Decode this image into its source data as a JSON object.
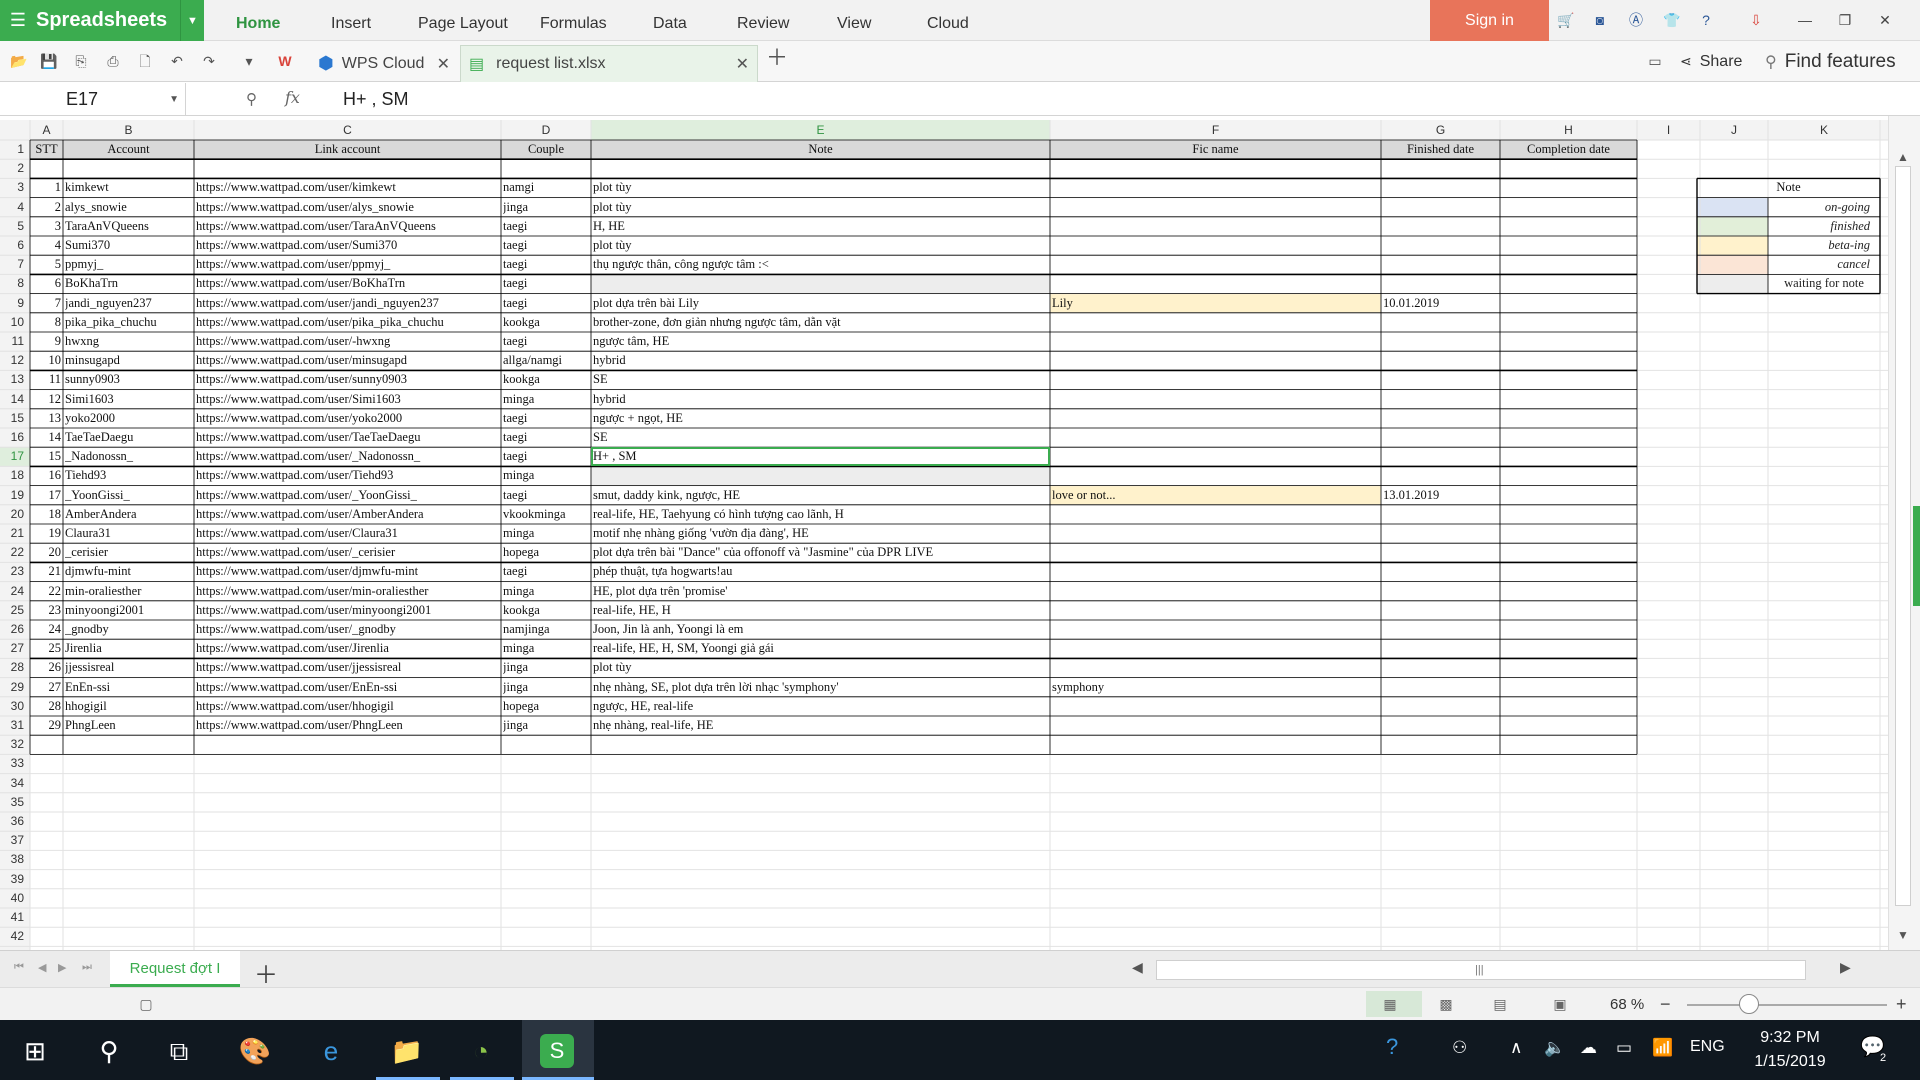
{
  "app": {
    "name": "Spreadsheets",
    "menu_tabs": [
      "Home",
      "Insert",
      "Page Layout",
      "Formulas",
      "Data",
      "Review",
      "View",
      "Cloud"
    ],
    "active_tab": "Home",
    "signin": "Sign in"
  },
  "toolbar": {
    "wps_cloud": "WPS Cloud",
    "doc_name": "request list.xlsx",
    "share": "Share",
    "find": "Find features"
  },
  "formula_bar": {
    "cell_ref": "E17",
    "fx": "fx",
    "content": "H+ , SM"
  },
  "grid": {
    "columns": [
      "A",
      "B",
      "C",
      "D",
      "E",
      "F",
      "G",
      "H",
      "I",
      "J",
      "K"
    ],
    "headers": [
      "STT",
      "Account",
      "Link account",
      "Couple",
      "Note",
      "Fic name",
      "Finished date",
      "Completion date"
    ],
    "rows": [
      {
        "stt": "1",
        "account": "kimkewt",
        "link": "https://www.wattpad.com/user/kimkewt",
        "couple": "namgi",
        "note": "plot tùy",
        "fic": "",
        "finished": ""
      },
      {
        "stt": "2",
        "account": "alys_snowie",
        "link": "https://www.wattpad.com/user/alys_snowie",
        "couple": "jinga",
        "note": "plot tùy",
        "fic": "",
        "finished": ""
      },
      {
        "stt": "3",
        "account": "TaraAnVQueens",
        "link": "https://www.wattpad.com/user/TaraAnVQueens",
        "couple": "taegi",
        "note": "H, HE",
        "fic": "",
        "finished": ""
      },
      {
        "stt": "4",
        "account": "Sumi370",
        "link": "https://www.wattpad.com/user/Sumi370",
        "couple": "taegi",
        "note": "plot tùy",
        "fic": "",
        "finished": ""
      },
      {
        "stt": "5",
        "account": "ppmyj_",
        "link": "https://www.wattpad.com/user/ppmyj_",
        "couple": "taegi",
        "note": "thụ ngược thân, công ngược tâm :<",
        "fic": "",
        "finished": ""
      },
      {
        "stt": "6",
        "account": "BoKhaTrn",
        "link": "https://www.wattpad.com/user/BoKhaTrn",
        "couple": "taegi",
        "note": "",
        "fic": "",
        "finished": "",
        "status": "waiting"
      },
      {
        "stt": "7",
        "account": "jandi_nguyen237",
        "link": "https://www.wattpad.com/user/jandi_nguyen237",
        "couple": "taegi",
        "note": "plot dựa trên bài Lily",
        "fic": "Lily",
        "finished": "10.01.2019",
        "status": "beta"
      },
      {
        "stt": "8",
        "account": "pika_pika_chuchu",
        "link": "https://www.wattpad.com/user/pika_pika_chuchu",
        "couple": "kookga",
        "note": "brother-zone, đơn giản nhưng ngược tâm, dằn vặt",
        "fic": "",
        "finished": ""
      },
      {
        "stt": "9",
        "account": "hwxng",
        "link": "https://www.wattpad.com/user/-hwxng",
        "couple": "taegi",
        "note": "ngược tâm, HE",
        "fic": "",
        "finished": ""
      },
      {
        "stt": "10",
        "account": "minsugapd",
        "link": "https://www.wattpad.com/user/minsugapd",
        "couple": "allga/namgi",
        "note": "hybrid",
        "fic": "",
        "finished": ""
      },
      {
        "stt": "11",
        "account": "sunny0903",
        "link": "https://www.wattpad.com/user/sunny0903",
        "couple": "kookga",
        "note": "SE",
        "fic": "",
        "finished": ""
      },
      {
        "stt": "12",
        "account": "Simi1603",
        "link": "https://www.wattpad.com/user/Simi1603",
        "couple": "minga",
        "note": "hybrid",
        "fic": "",
        "finished": ""
      },
      {
        "stt": "13",
        "account": "yoko2000",
        "link": "https://www.wattpad.com/user/yoko2000",
        "couple": "taegi",
        "note": "ngược + ngọt, HE",
        "fic": "",
        "finished": ""
      },
      {
        "stt": "14",
        "account": "TaeTaeDaegu",
        "link": "https://www.wattpad.com/user/TaeTaeDaegu",
        "couple": "taegi",
        "note": "SE",
        "fic": "",
        "finished": ""
      },
      {
        "stt": "15",
        "account": "_Nadonossn_",
        "link": "https://www.wattpad.com/user/_Nadonossn_",
        "couple": "taegi",
        "note": "H+ , SM",
        "fic": "",
        "finished": ""
      },
      {
        "stt": "16",
        "account": "Tiehd93",
        "link": "https://www.wattpad.com/user/Tiehd93",
        "couple": "minga",
        "note": "",
        "fic": "",
        "finished": "",
        "status": "waiting"
      },
      {
        "stt": "17",
        "account": "_YoonGissi_",
        "link": "https://www.wattpad.com/user/_YoonGissi_",
        "couple": "taegi",
        "note": "smut, daddy kink, ngược, HE",
        "fic": "love or not...",
        "finished": "13.01.2019",
        "status": "beta"
      },
      {
        "stt": "18",
        "account": "AmberAndera",
        "link": "https://www.wattpad.com/user/AmberAndera",
        "couple": "vkookminga",
        "note": "real-life, HE, Taehyung có hình tượng cao lãnh, H",
        "fic": "",
        "finished": ""
      },
      {
        "stt": "19",
        "account": "Claura31",
        "link": "https://www.wattpad.com/user/Claura31",
        "couple": "minga",
        "note": "motif nhẹ nhàng giống 'vườn địa đàng', HE",
        "fic": "",
        "finished": ""
      },
      {
        "stt": "20",
        "account": "_cerisier",
        "link": "https://www.wattpad.com/user/_cerisier",
        "couple": "hopega",
        "note": "plot dựa trên bài \"Dance\" của offonoff và \"Jasmine\" của DPR LIVE",
        "fic": "",
        "finished": ""
      },
      {
        "stt": "21",
        "account": "djmwfu-mint",
        "link": "https://www.wattpad.com/user/djmwfu-mint",
        "couple": "taegi",
        "note": "phép thuật, tựa hogwarts!au",
        "fic": "",
        "finished": ""
      },
      {
        "stt": "22",
        "account": "min-oraliesther",
        "link": "https://www.wattpad.com/user/min-oraliesther",
        "couple": "minga",
        "note": "HE, plot dựa trên 'promise'",
        "fic": "",
        "finished": ""
      },
      {
        "stt": "23",
        "account": "minyoongi2001",
        "link": "https://www.wattpad.com/user/minyoongi2001",
        "couple": "kookga",
        "note": "real-life, HE, H",
        "fic": "",
        "finished": ""
      },
      {
        "stt": "24",
        "account": "_gnodby",
        "link": "https://www.wattpad.com/user/_gnodby",
        "couple": "namjinga",
        "note": "Joon, Jin là anh, Yoongi là em",
        "fic": "",
        "finished": ""
      },
      {
        "stt": "25",
        "account": "Jirenlia",
        "link": "https://www.wattpad.com/user/Jirenlia",
        "couple": "minga",
        "note": "real-life, HE, H, SM, Yoongi giả gái",
        "fic": "",
        "finished": ""
      },
      {
        "stt": "26",
        "account": "jjessisreal",
        "link": "https://www.wattpad.com/user/jjessisreal",
        "couple": "jinga",
        "note": "plot tùy",
        "fic": "",
        "finished": ""
      },
      {
        "stt": "27",
        "account": "EnEn-ssi",
        "link": "https://www.wattpad.com/user/EnEn-ssi",
        "couple": "jinga",
        "note": "nhẹ nhàng, SE, plot dựa trên lời nhạc 'symphony'",
        "fic": "symphony",
        "finished": ""
      },
      {
        "stt": "28",
        "account": "hhogigil",
        "link": "https://www.wattpad.com/user/hhogigil",
        "couple": "hopega",
        "note": "ngược, HE, real-life",
        "fic": "",
        "finished": ""
      },
      {
        "stt": "29",
        "account": "PhngLeen",
        "link": "https://www.wattpad.com/user/PhngLeen",
        "couple": "jinga",
        "note": "nhẹ nhàng, real-life, HE",
        "fic": "",
        "finished": ""
      }
    ],
    "legend": {
      "title": "Note",
      "items": [
        {
          "label": "on-going",
          "color": "#dae3f3"
        },
        {
          "label": "finished",
          "color": "#e2efd9"
        },
        {
          "label": "beta-ing",
          "color": "#fff2cc"
        },
        {
          "label": "cancel",
          "color": "#fbe5d6"
        },
        {
          "label": "waiting for note",
          "color": "#ededed"
        }
      ]
    },
    "colors": {
      "beta": "#fff2cc",
      "waiting": "#ededed",
      "header_fill": "#d9d9d9",
      "selection": "#3bac4f"
    }
  },
  "sheet_tab": "Request đợt I",
  "status": {
    "zoom": "68 %",
    "zoom_level_percent": 68
  },
  "taskbar": {
    "language": "ENG",
    "time": "9:32 PM",
    "date": "1/15/2019",
    "notifications": "2"
  }
}
